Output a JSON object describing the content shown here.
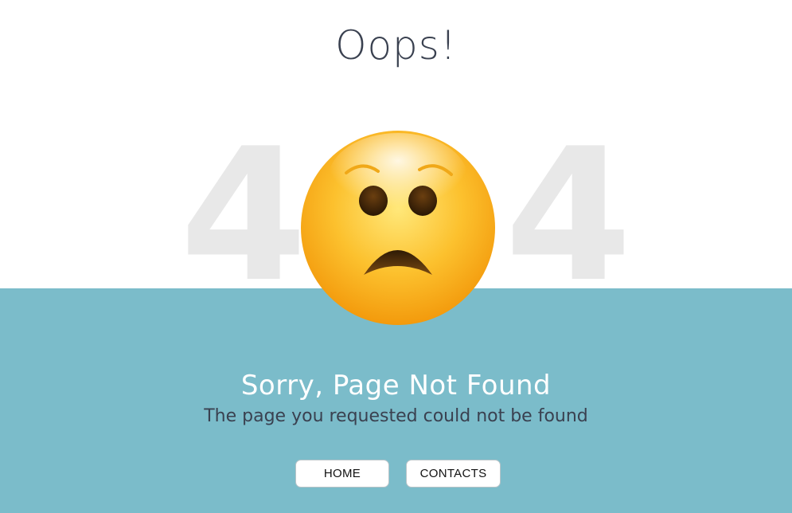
{
  "header": {
    "title": "Oops!"
  },
  "error": {
    "digit_left": "4",
    "digit_right": "4",
    "face_icon": "sad-face-emoji",
    "headline": "Sorry, Page Not Found",
    "message": "The page you requested could not be found"
  },
  "actions": {
    "home_label": "HOME",
    "contacts_label": "CONTACTS"
  },
  "colors": {
    "band": "#7bbcca",
    "title_text": "#3a4150",
    "digits": "#e8e8e8",
    "emoji_yellow": "#fbbf2a"
  }
}
